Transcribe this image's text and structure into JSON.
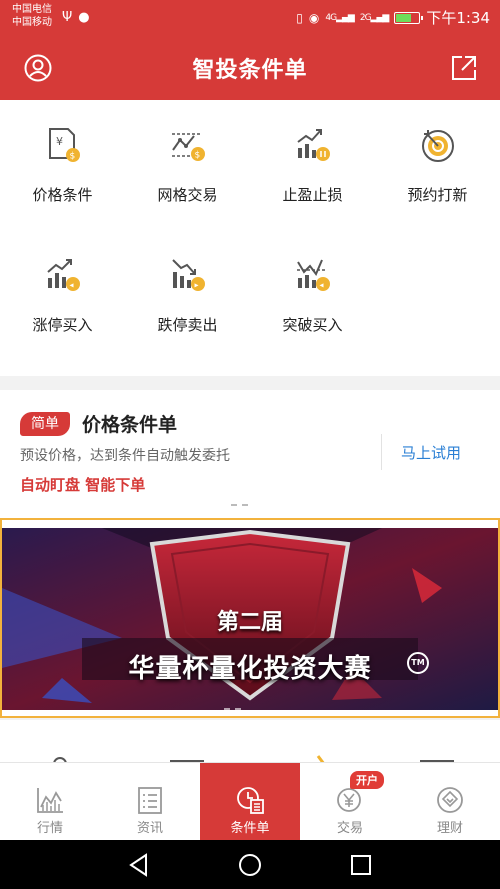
{
  "status_bar": {
    "carrier1": "中国电信",
    "carrier2": "中国移动",
    "usb_icon": "usb-icon",
    "chat_icon": "chat-bubble-icon",
    "net_4g": "4G",
    "net_2g": "2G",
    "time": "下午1:34"
  },
  "header": {
    "title": "智投条件单",
    "left_icon": "user-icon",
    "right_icon": "share-icon"
  },
  "functions": [
    {
      "label": "价格条件",
      "icon": "price-document-icon"
    },
    {
      "label": "网格交易",
      "icon": "grid-trade-icon"
    },
    {
      "label": "止盈止损",
      "icon": "stop-profit-loss-icon"
    },
    {
      "label": "预约打新",
      "icon": "target-icon"
    },
    {
      "label": "涨停买入",
      "icon": "limit-up-buy-icon"
    },
    {
      "label": "跌停卖出",
      "icon": "limit-down-sell-icon"
    },
    {
      "label": "突破买入",
      "icon": "breakout-buy-icon"
    }
  ],
  "promo": {
    "tag": "简单",
    "title": "价格条件单",
    "description": "预设价格，达到条件自动触发委托",
    "features": "自动盯盘 智能下单",
    "cta": "马上试用"
  },
  "banner": {
    "line1": "第二届",
    "line2": "华量杯量化投资大赛",
    "tm": "TM"
  },
  "tabs": [
    {
      "label": "行情",
      "icon": "market-chart-icon",
      "active": false
    },
    {
      "label": "资讯",
      "icon": "news-list-icon",
      "active": false
    },
    {
      "label": "条件单",
      "icon": "conditional-order-icon",
      "active": true
    },
    {
      "label": "交易",
      "icon": "yen-trade-icon",
      "active": false,
      "badge": "开户"
    },
    {
      "label": "理财",
      "icon": "wealth-icon",
      "active": false
    }
  ],
  "colors": {
    "brand_red": "#d63a38",
    "cta_blue": "#2a7fd4",
    "icon_gold": "#f0b330",
    "icon_gray": "#555555"
  }
}
